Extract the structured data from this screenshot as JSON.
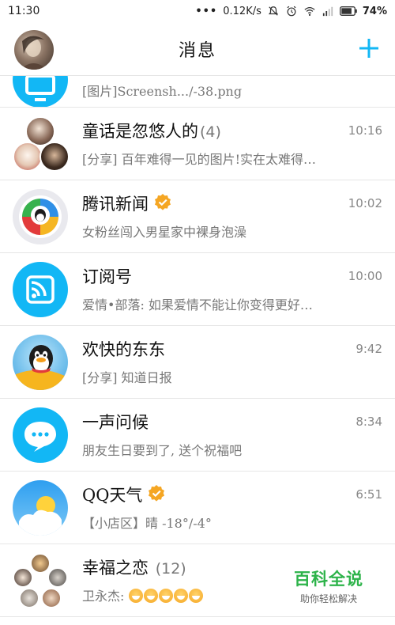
{
  "status_bar": {
    "time": "11:30",
    "network_speed": "0.12K/s",
    "battery": "74%"
  },
  "header": {
    "title": "消息",
    "add_icon": "plus-icon"
  },
  "conversations": [
    {
      "id": "partial",
      "name": "",
      "preview": "[图片]Screensh.../-38.png",
      "time": ""
    },
    {
      "id": "fairytale",
      "name": "童话是忽悠人的",
      "count": "(4)",
      "preview": "[分享] 百年难得一见的图片!实在太难得…",
      "time": "10:16"
    },
    {
      "id": "tencent-news",
      "name": "腾讯新闻",
      "verified": true,
      "preview": "女粉丝闯入男星家中裸身泡澡",
      "time": "10:02"
    },
    {
      "id": "subscriptions",
      "name": "订阅号",
      "preview": "爱情•部落: 如果爱情不能让你变得更好…",
      "time": "10:00"
    },
    {
      "id": "happy",
      "name": "欢快的东东",
      "preview": "[分享] 知道日报",
      "time": "9:42"
    },
    {
      "id": "greeting",
      "name": "一声问候",
      "preview": "朋友生日要到了, 送个祝福吧",
      "time": "8:34"
    },
    {
      "id": "weather",
      "name": "QQ天气",
      "verified": true,
      "preview": "【小店区】晴 -18°/-4°",
      "time": "6:51"
    },
    {
      "id": "love",
      "name": "幸福之恋",
      "count": "(12)",
      "preview": "卫永杰: ",
      "time": ""
    }
  ],
  "watermark": {
    "title": "百科全说",
    "subtitle": "助你轻松解决"
  },
  "colors": {
    "qq_blue": "#12b7f5",
    "verified_orange": "#f5a623",
    "watermark_green": "#2db34a"
  }
}
